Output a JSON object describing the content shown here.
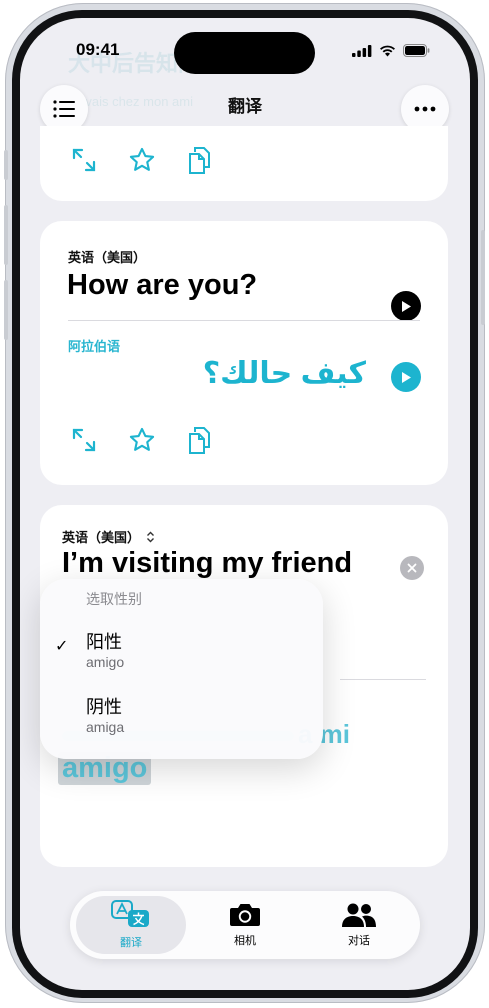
{
  "status_bar": {
    "time": "09:41"
  },
  "nav": {
    "title": "翻译"
  },
  "ghost": {
    "header": "大中后告知门",
    "sub": "Je vais chez mon ami"
  },
  "card_mid": {
    "source_language": "英语（美国）",
    "source_text": "How are you?",
    "target_language": "阿拉伯语",
    "target_text": "كيف حالك؟"
  },
  "card_bottom": {
    "source_language": "英语（美国）",
    "source_text": "I’m visiting my friend",
    "target_text_partial": "a mi",
    "highlighted_word": "amigo"
  },
  "gender_popover": {
    "header": "选取性别",
    "options": [
      {
        "title": "阳性",
        "subtitle": "amigo",
        "selected": true
      },
      {
        "title": "阴性",
        "subtitle": "amiga",
        "selected": false
      }
    ]
  },
  "tabs": [
    {
      "label": "翻译",
      "icon": "translate-icon",
      "active": true
    },
    {
      "label": "相机",
      "icon": "camera-icon",
      "active": false
    },
    {
      "label": "对话",
      "icon": "people-icon",
      "active": false
    }
  ],
  "colors": {
    "accent": "#1db4cf",
    "background": "#eeeef3",
    "card": "#ffffff"
  }
}
